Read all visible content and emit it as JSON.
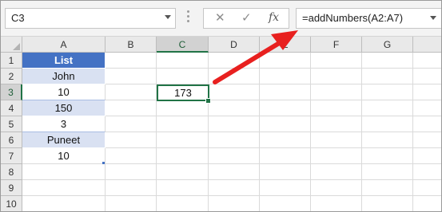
{
  "namebox": {
    "value": "C3"
  },
  "formula_bar": {
    "cancel_glyph": "✕",
    "enter_glyph": "✓",
    "function_glyph": "fx",
    "value": "=addNumbers(A2:A7)"
  },
  "columns": [
    "A",
    "B",
    "C",
    "D",
    "E",
    "F",
    "G"
  ],
  "rows": [
    "1",
    "2",
    "3",
    "4",
    "5",
    "6",
    "7",
    "8",
    "9",
    "10"
  ],
  "cells": {
    "A1": "List",
    "A2": "John",
    "A3": "10",
    "A4": "150",
    "A5": "3",
    "A6": "Puneet",
    "A7": "10",
    "C3": "173"
  },
  "selection": {
    "active_cell": "C3",
    "active_column": "C",
    "active_row": "3"
  },
  "colors": {
    "table_header": "#4472c4",
    "table_band": "#d9e1f2",
    "selection": "#217346",
    "annotation_arrow": "#e8201f"
  },
  "icons": {
    "namebox_dropdown": "chevron-down-icon",
    "cancel": "close-icon",
    "enter": "check-icon",
    "function": "function-icon",
    "expand": "chevron-down-icon",
    "select_all": "select-all-icon",
    "annotation": "red-arrow-icon"
  }
}
